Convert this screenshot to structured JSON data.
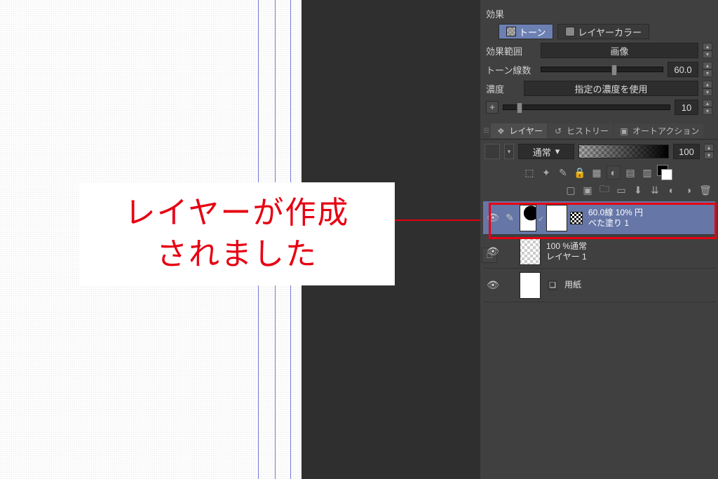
{
  "callout": {
    "line1": "レイヤーが作成",
    "line2": "されました"
  },
  "effects": {
    "title": "効果",
    "opts": {
      "tone": "トーン",
      "layercolor": "レイヤーカラー"
    },
    "range_label": "効果範囲",
    "range_value": "画像",
    "lines_label": "トーン線数",
    "lines_value": "60.0",
    "density_label": "濃度",
    "density_value": "指定の濃度を使用",
    "extra_value": "10"
  },
  "tabs": {
    "layer": "レイヤー",
    "history": "ヒストリー",
    "autoaction": "オートアクション"
  },
  "blend": {
    "mode": "通常",
    "opacity": "100"
  },
  "layers": [
    {
      "meta": "60.0線 10% 円",
      "name": "べた塗り 1"
    },
    {
      "meta": "100 %通常",
      "name": "レイヤー 1"
    },
    {
      "name": "用紙"
    }
  ]
}
